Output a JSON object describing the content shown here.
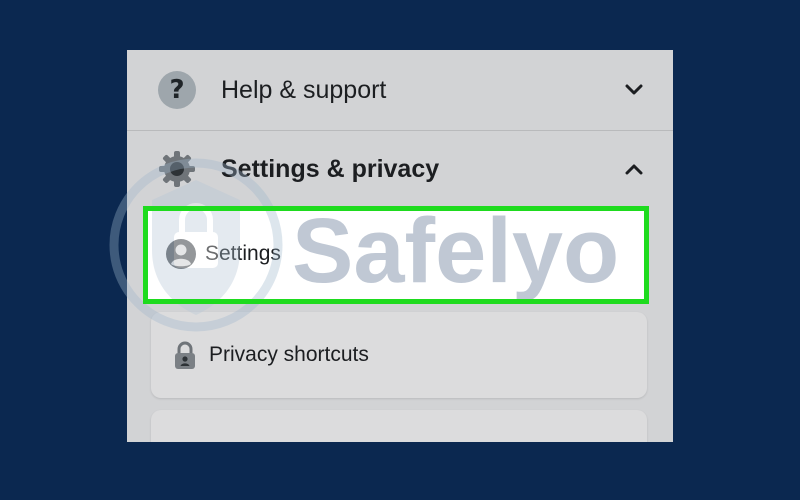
{
  "menu": {
    "help": {
      "label": "Help & support",
      "icon": "question-icon",
      "chevron": "chevron-down"
    },
    "settings_privacy": {
      "label": "Settings & privacy",
      "icon": "gear-icon",
      "chevron": "chevron-up"
    },
    "items": [
      {
        "label": "Settings",
        "icon": "person-circle-icon",
        "highlighted": true
      },
      {
        "label": "Privacy shortcuts",
        "icon": "lock-person-icon"
      }
    ]
  },
  "help_glyph": "?",
  "watermark_text": "Safelyo",
  "colors": {
    "background": "#0b2850",
    "panel": "#d2d3d5",
    "highlight_border": "#1edb1e"
  }
}
